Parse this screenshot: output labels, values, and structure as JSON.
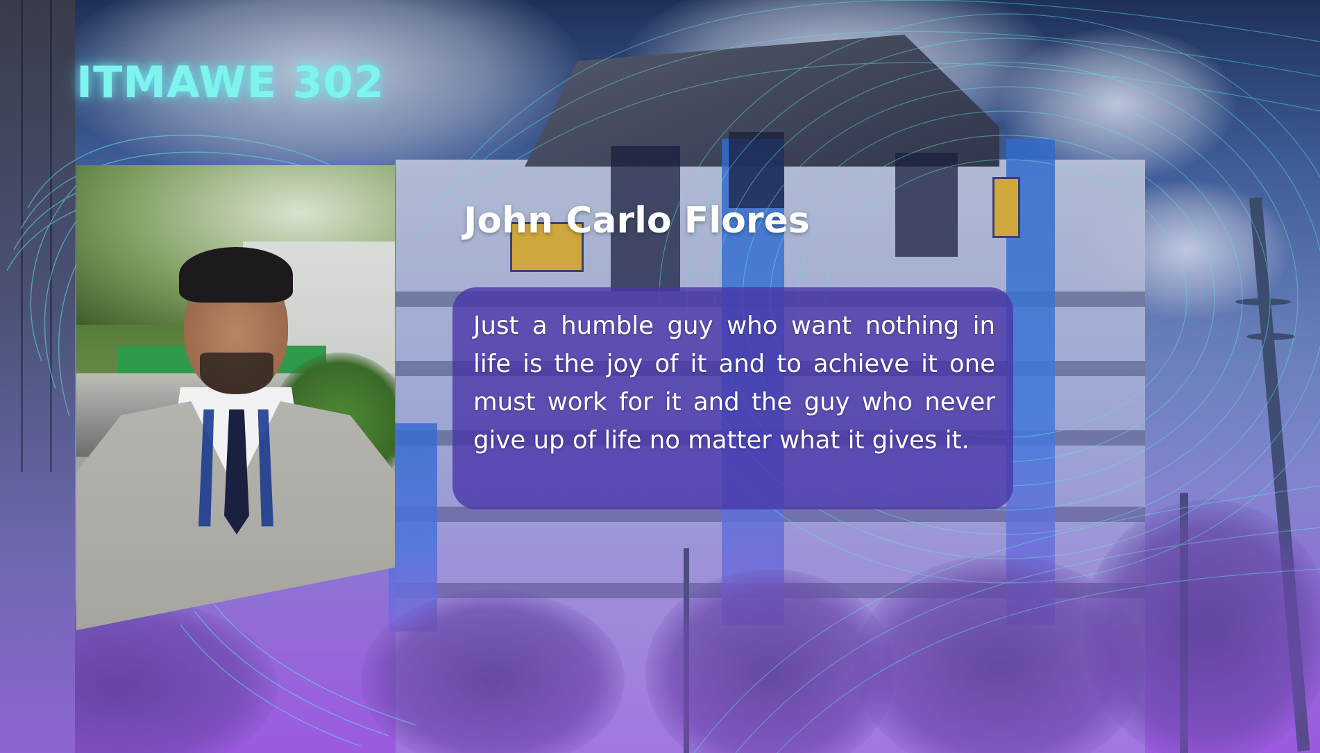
{
  "slide": {
    "course_code": "ITMAWE 302",
    "student_name": "John Carlo Flores",
    "bio": "Just a humble guy who want nothing in life is the joy of it and to achieve it one must work for it and the guy who never give up of life no matter what it gives it."
  },
  "background": {
    "scene": "campus-building-icon",
    "signs": [
      {
        "icon": "sti-logo-icon"
      },
      {
        "icon": "sti-logo-icon"
      }
    ]
  },
  "colors": {
    "title": "#7ff3ee",
    "card": "#4834a8",
    "wave_lines": "#5fe3e0"
  }
}
